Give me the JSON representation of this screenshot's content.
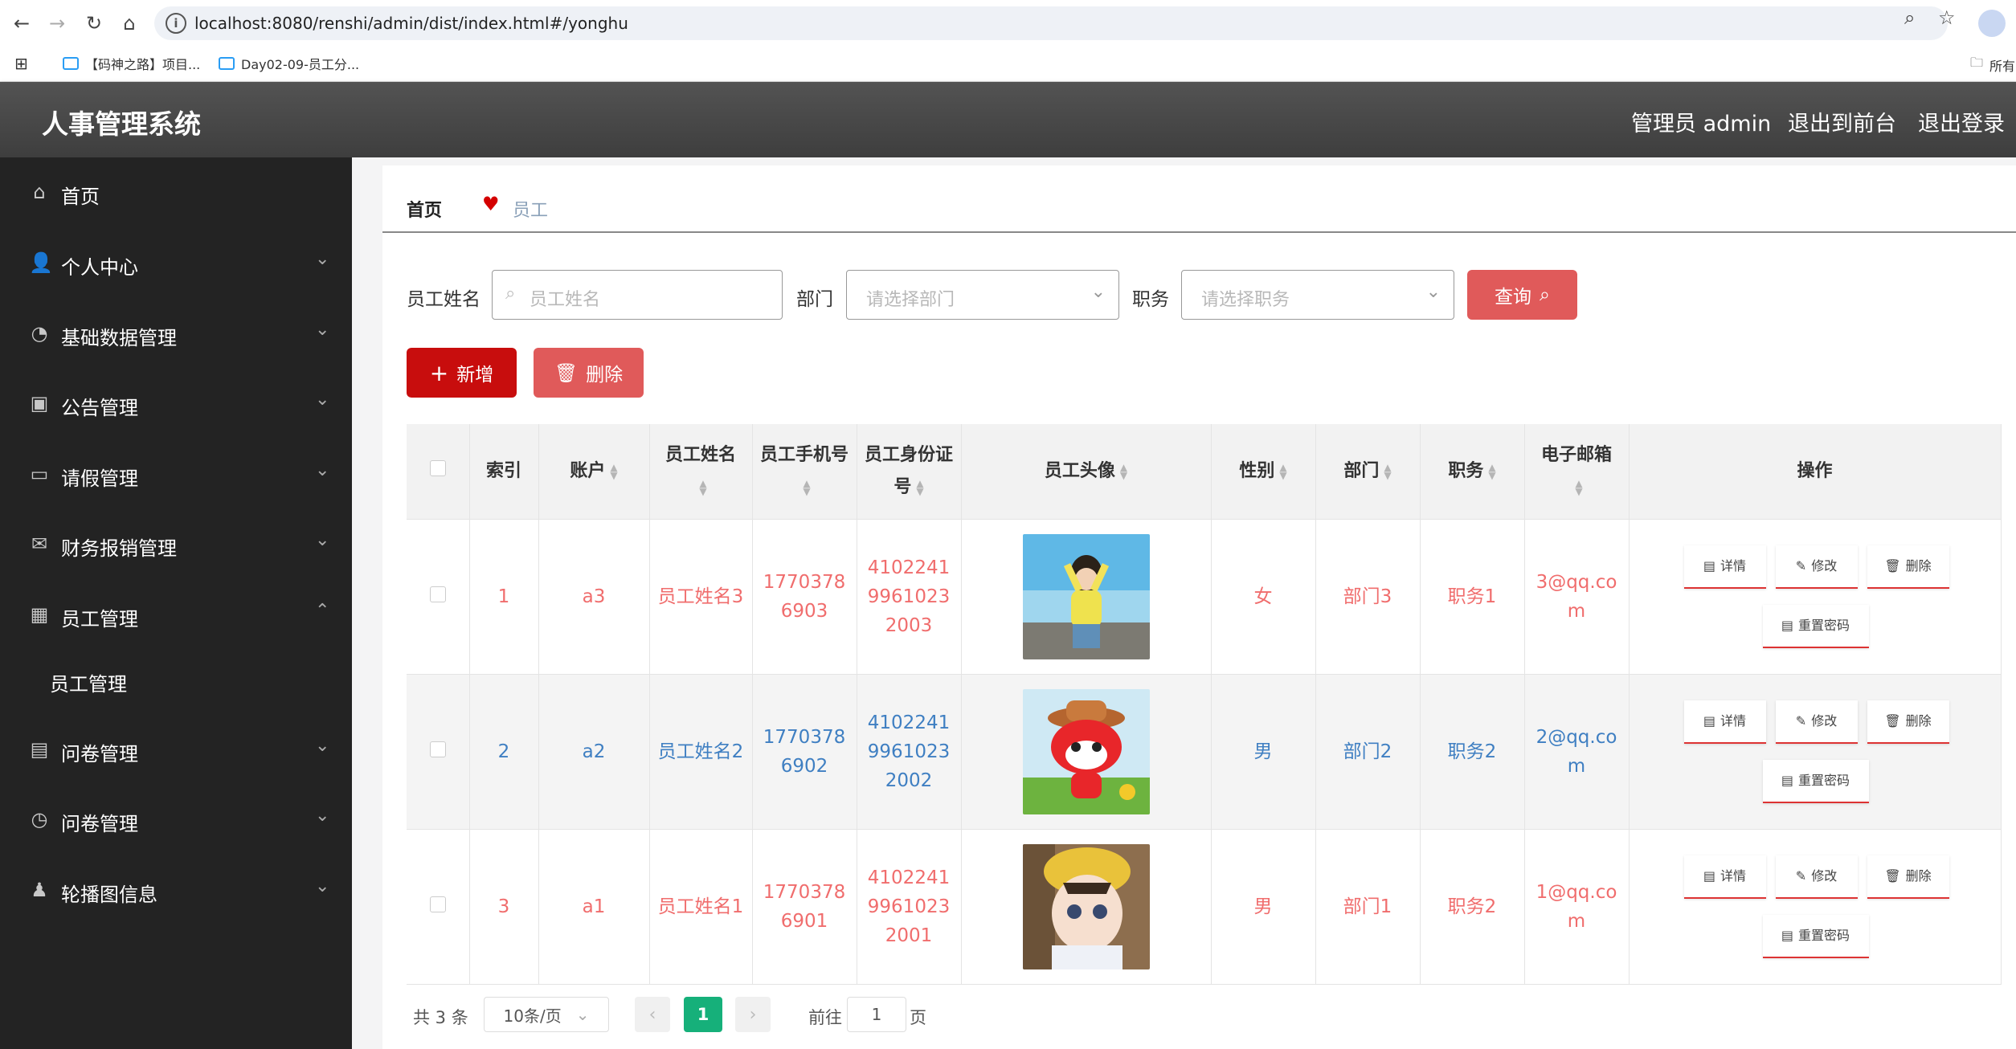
{
  "browser": {
    "url": "localhost:8080/renshi/admin/dist/index.html#/yonghu",
    "bookmarks": [
      "【码神之路】项目...",
      "Day02-09-员工分..."
    ],
    "bookmarks_right": "所有"
  },
  "header": {
    "title": "人事管理系统",
    "admin_label": "管理员 admin",
    "to_front": "退出到前台",
    "logout": "退出登录"
  },
  "sidebar": {
    "items": [
      {
        "label": "首页",
        "icon": "home-icon"
      },
      {
        "label": "个人中心",
        "icon": "user-icon"
      },
      {
        "label": "基础数据管理",
        "icon": "gauge-icon"
      },
      {
        "label": "公告管理",
        "icon": "briefcase-icon"
      },
      {
        "label": "请假管理",
        "icon": "card-icon"
      },
      {
        "label": "财务报销管理",
        "icon": "mail-icon"
      },
      {
        "label": "员工管理",
        "icon": "grid-icon"
      },
      {
        "label": "问卷管理",
        "icon": "clipboard-icon"
      },
      {
        "label": "问卷管理",
        "icon": "clock-icon"
      },
      {
        "label": "轮播图信息",
        "icon": "stamp-icon"
      }
    ],
    "sub_item": "员工管理"
  },
  "breadcrumb": {
    "home": "首页",
    "current": "员工"
  },
  "filters": {
    "name_label": "员工姓名",
    "name_placeholder": "员工姓名",
    "dept_label": "部门",
    "dept_placeholder": "请选择部门",
    "job_label": "职务",
    "job_placeholder": "请选择职务",
    "query_label": "查询"
  },
  "actions": {
    "add_label": "新增",
    "delete_label": "删除"
  },
  "table": {
    "headers": {
      "index": "索引",
      "account": "账户",
      "name": "员工姓名",
      "phone": "员工手机号",
      "id_card": "员工身份证号",
      "avatar": "员工头像",
      "gender": "性别",
      "dept": "部门",
      "job": "职务",
      "email": "电子邮箱",
      "ops": "操作"
    },
    "rows": [
      {
        "index": "1",
        "account": "a3",
        "name": "员工姓名3",
        "phone": "17703786903",
        "id_card": "410224199610232003",
        "gender": "女",
        "dept": "部门3",
        "job": "职务1",
        "email": "3@qq.com"
      },
      {
        "index": "2",
        "account": "a2",
        "name": "员工姓名2",
        "phone": "17703786902",
        "id_card": "410224199610232002",
        "gender": "男",
        "dept": "部门2",
        "job": "职务2",
        "email": "2@qq.com"
      },
      {
        "index": "3",
        "account": "a1",
        "name": "员工姓名1",
        "phone": "17703786901",
        "id_card": "410224199610232001",
        "gender": "男",
        "dept": "部门1",
        "job": "职务2",
        "email": "1@qq.com"
      }
    ],
    "op_labels": {
      "detail": "详情",
      "edit": "修改",
      "delete": "删除",
      "reset": "重置密码"
    }
  },
  "pagination": {
    "total": "共 3 条",
    "page_size": "10条/页",
    "current_page": "1",
    "goto_label": "前往",
    "goto_value": "1",
    "page_suffix": "页"
  }
}
